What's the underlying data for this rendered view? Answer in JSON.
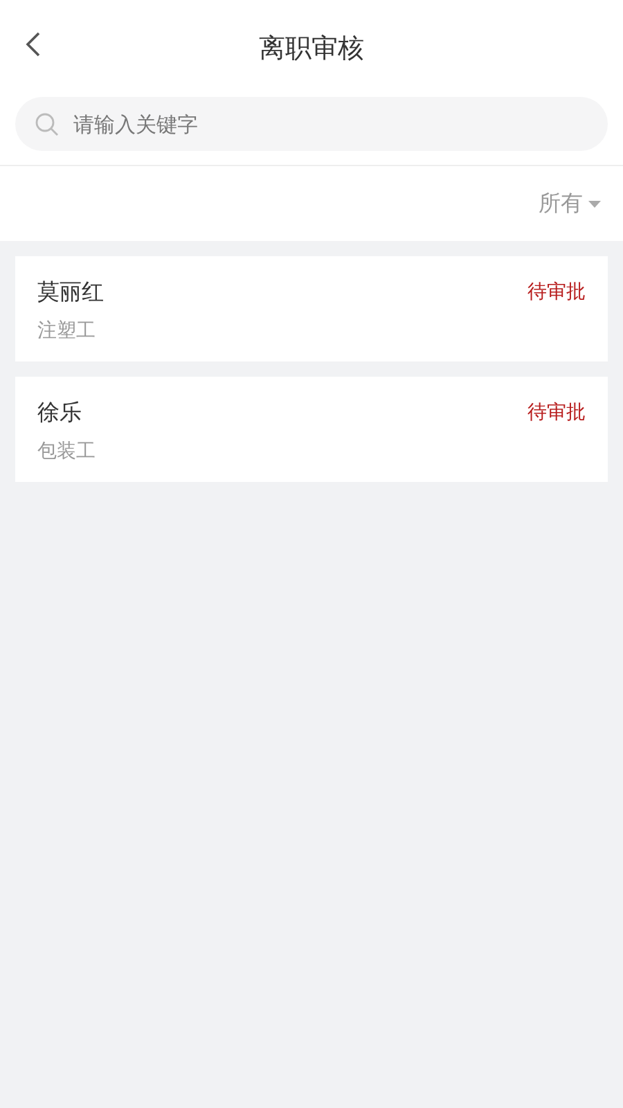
{
  "header": {
    "title": "离职审核"
  },
  "search": {
    "placeholder": "请输入关键字"
  },
  "filter": {
    "label": "所有"
  },
  "items": [
    {
      "name": "莫丽红",
      "role": "注塑工",
      "status": "待审批"
    },
    {
      "name": "徐乐",
      "role": "包装工",
      "status": "待审批"
    }
  ]
}
